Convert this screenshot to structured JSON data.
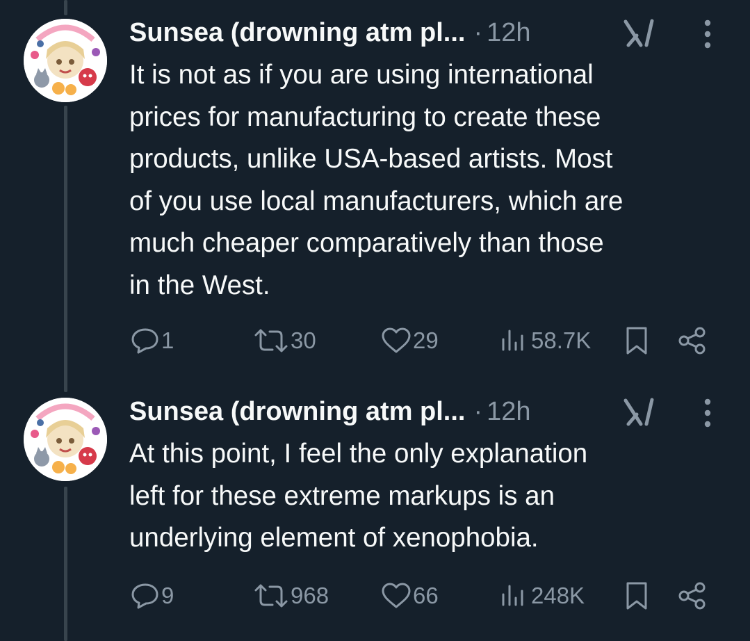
{
  "tweets": [
    {
      "author_name": "Sunsea (drowning atm pl...",
      "separator": "·",
      "timestamp": "12h",
      "text": "It is not as if you are using international\nprices for manufacturing to create these\nproducts, unlike USA-based artists. Most\nof you use local manufacturers, which are\nmuch cheaper comparatively than those\nin the West.",
      "stats": {
        "replies": "1",
        "reposts": "30",
        "likes": "29",
        "views": "58.7K"
      }
    },
    {
      "author_name": "Sunsea (drowning atm pl...",
      "separator": "·",
      "timestamp": "12h",
      "text": "At this point, I feel the only explanation\nleft for these extreme markups is an\nunderlying element of xenophobia.",
      "stats": {
        "replies": "9",
        "reposts": "968",
        "likes": "66",
        "views": "248K"
      }
    }
  ],
  "icons": {
    "reply": "reply-icon",
    "repost": "repost-icon",
    "like": "heart-icon",
    "views": "views-icon",
    "bookmark": "bookmark-icon",
    "share": "share-icon",
    "grok": "grok-icon",
    "more": "more-icon"
  },
  "colors": {
    "background": "#15202b",
    "text": "#f7f9f9",
    "secondary": "#8b98a5",
    "thread_line": "#38444d"
  }
}
